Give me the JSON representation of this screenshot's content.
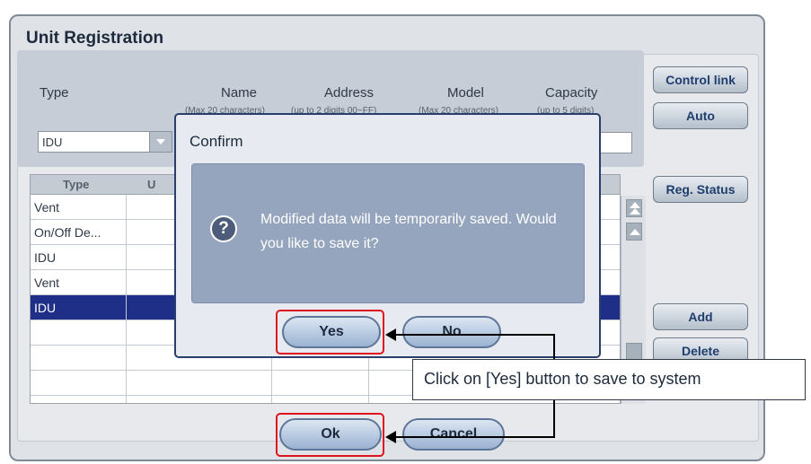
{
  "window": {
    "title": "Unit Registration"
  },
  "form": {
    "headers": [
      {
        "label": "Type",
        "sub": ""
      },
      {
        "label": "Name",
        "sub": "(Max 20 characters)"
      },
      {
        "label": "Address",
        "sub": "(up to 2 digits 00~FF)"
      },
      {
        "label": "Model",
        "sub": "(Max 20 characters)"
      },
      {
        "label": "Capacity",
        "sub": "(up to 5 digits)"
      }
    ],
    "type_value": "IDU"
  },
  "side_buttons": {
    "control_link": "Control link",
    "auto": "Auto",
    "reg_status": "Reg. Status",
    "add": "Add",
    "delete": "Delete"
  },
  "table": {
    "col_type": "Type",
    "col_u": "U",
    "rows": [
      "Vent",
      "On/Off De...",
      "IDU",
      "Vent",
      "IDU",
      "",
      "",
      ""
    ],
    "selected_index": 4
  },
  "bottom": {
    "ok": "Ok",
    "cancel": "Cancel"
  },
  "dialog": {
    "title": "Confirm",
    "icon": "question-icon",
    "message": "Modified data will be temporarily saved.  Would you like to save it?",
    "yes": "Yes",
    "no": "No"
  },
  "annotation": {
    "text": "Click on [Yes] button to save to system",
    "highlight_color": "#e0141d"
  }
}
